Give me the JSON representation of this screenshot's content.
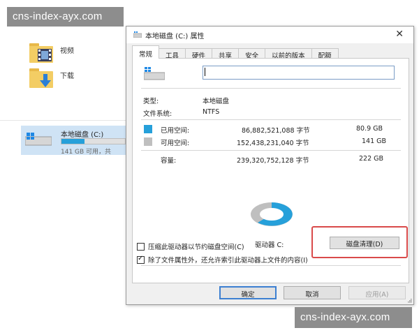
{
  "watermark": {
    "top": "cns-index-ayx.com",
    "bottom": "cns-index-ayx.com"
  },
  "explorer": {
    "folders": [
      {
        "label": "视频",
        "icon": "video-folder-icon"
      },
      {
        "label": "下载",
        "icon": "download-folder-icon"
      }
    ],
    "drive": {
      "name": "本地磁盘 (C:)",
      "free_text": "141 GB 可用，共",
      "usage_fraction": 0.36,
      "icon": "drive-icon"
    }
  },
  "dialog": {
    "title": "本地磁盘 (C:) 属性",
    "close_glyph": "✕",
    "tabs": [
      "常规",
      "工具",
      "硬件",
      "共享",
      "安全",
      "以前的版本",
      "配额"
    ],
    "active_tab": "常规",
    "name_value": "",
    "type_label": "类型:",
    "type_value": "本地磁盘",
    "fs_label": "文件系统:",
    "fs_value": "NTFS",
    "used": {
      "label": "已用空间:",
      "bytes": "86,882,521,088 字节",
      "size": "80.9 GB",
      "color": "#26a0da"
    },
    "free": {
      "label": "可用空间:",
      "bytes": "152,438,231,040 字节",
      "size": "141 GB",
      "color": "#bfbfbf"
    },
    "capacity": {
      "label": "容量:",
      "bytes": "239,320,752,128 字节",
      "size": "222 GB"
    },
    "drive_label": "驱动器 C:",
    "cleanup_button": "磁盘清理(D)",
    "compress_label": "压缩此驱动器以节约磁盘空间(C)",
    "index_label": "除了文件属性外，还允许索引此驱动器上文件的内容(I)",
    "compress_checked": false,
    "index_checked": true,
    "ok_button": "确定",
    "cancel_button": "取消",
    "apply_button": "应用(A)",
    "highlight_color": "#d94a4a"
  }
}
